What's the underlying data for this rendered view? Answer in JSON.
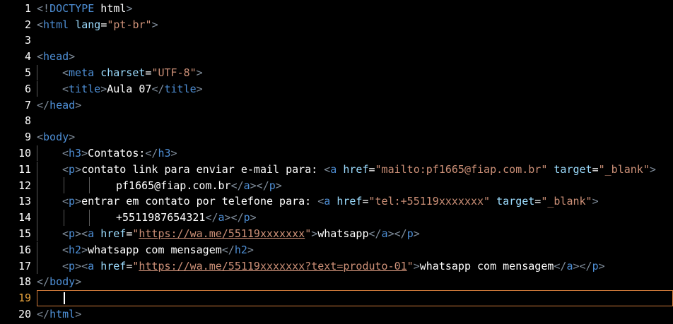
{
  "editor": {
    "current_line": 19,
    "colors": {
      "background": "#000000",
      "tag": "#4e8fd6",
      "attribute": "#9cdcfe",
      "string": "#ce9178",
      "text": "#ffffff",
      "punctuation": "#7f8c9a",
      "active_line_border": "#d07a3a"
    },
    "lines": [
      {
        "number": "1",
        "indent": 0,
        "tokens": [
          [
            "punc",
            "<!"
          ],
          [
            "tag",
            "DOCTYPE"
          ],
          [
            "text",
            " html"
          ],
          [
            "punc",
            ">"
          ]
        ]
      },
      {
        "number": "2",
        "indent": 0,
        "tokens": [
          [
            "punc",
            "<"
          ],
          [
            "tag",
            "html"
          ],
          [
            "text",
            " "
          ],
          [
            "attr",
            "lang"
          ],
          [
            "text",
            "="
          ],
          [
            "str",
            "\"pt-br\""
          ],
          [
            "punc",
            ">"
          ]
        ]
      },
      {
        "number": "3",
        "indent": 0,
        "tokens": []
      },
      {
        "number": "4",
        "indent": 0,
        "tokens": [
          [
            "punc",
            "<"
          ],
          [
            "tag",
            "head"
          ],
          [
            "punc",
            ">"
          ]
        ]
      },
      {
        "number": "5",
        "indent": 1,
        "tokens": [
          [
            "punc",
            "<"
          ],
          [
            "tag",
            "meta"
          ],
          [
            "text",
            " "
          ],
          [
            "attr",
            "charset"
          ],
          [
            "text",
            "="
          ],
          [
            "str",
            "\"UTF-8\""
          ],
          [
            "punc",
            ">"
          ]
        ]
      },
      {
        "number": "6",
        "indent": 1,
        "tokens": [
          [
            "punc",
            "<"
          ],
          [
            "tag",
            "title"
          ],
          [
            "punc",
            ">"
          ],
          [
            "text",
            "Aula 07"
          ],
          [
            "punc",
            "</"
          ],
          [
            "tag",
            "title"
          ],
          [
            "punc",
            ">"
          ]
        ]
      },
      {
        "number": "7",
        "indent": 0,
        "tokens": [
          [
            "punc",
            "</"
          ],
          [
            "tag",
            "head"
          ],
          [
            "punc",
            ">"
          ]
        ]
      },
      {
        "number": "8",
        "indent": 0,
        "tokens": []
      },
      {
        "number": "9",
        "indent": 0,
        "tokens": [
          [
            "punc",
            "<"
          ],
          [
            "tag",
            "body"
          ],
          [
            "punc",
            ">"
          ]
        ]
      },
      {
        "number": "10",
        "indent": 1,
        "tokens": [
          [
            "punc",
            "<"
          ],
          [
            "tag",
            "h3"
          ],
          [
            "punc",
            ">"
          ],
          [
            "text",
            "Contatos:"
          ],
          [
            "punc",
            "</"
          ],
          [
            "tag",
            "h3"
          ],
          [
            "punc",
            ">"
          ]
        ]
      },
      {
        "number": "11",
        "indent": 1,
        "tokens": [
          [
            "punc",
            "<"
          ],
          [
            "tag",
            "p"
          ],
          [
            "punc",
            ">"
          ],
          [
            "text",
            "contato link para enviar e-mail para: "
          ],
          [
            "punc",
            "<"
          ],
          [
            "tag",
            "a"
          ],
          [
            "text",
            " "
          ],
          [
            "attr",
            "href"
          ],
          [
            "text",
            "="
          ],
          [
            "str",
            "\"mailto:pf1665@fiap.com.br\""
          ],
          [
            "text",
            " "
          ],
          [
            "attr",
            "target"
          ],
          [
            "text",
            "="
          ],
          [
            "str",
            "\"_blank\""
          ],
          [
            "punc",
            ">"
          ]
        ]
      },
      {
        "number": "12",
        "indent": 3,
        "tokens": [
          [
            "text",
            "pf1665@fiap.com.br"
          ],
          [
            "punc",
            "</"
          ],
          [
            "tag",
            "a"
          ],
          [
            "punc",
            "></"
          ],
          [
            "tag",
            "p"
          ],
          [
            "punc",
            ">"
          ]
        ]
      },
      {
        "number": "13",
        "indent": 1,
        "tokens": [
          [
            "punc",
            "<"
          ],
          [
            "tag",
            "p"
          ],
          [
            "punc",
            ">"
          ],
          [
            "text",
            "entrar em contato por telefone para: "
          ],
          [
            "punc",
            "<"
          ],
          [
            "tag",
            "a"
          ],
          [
            "text",
            " "
          ],
          [
            "attr",
            "href"
          ],
          [
            "text",
            "="
          ],
          [
            "str",
            "\"tel:+55119xxxxxxx\""
          ],
          [
            "text",
            " "
          ],
          [
            "attr",
            "target"
          ],
          [
            "text",
            "="
          ],
          [
            "str",
            "\"_blank\""
          ],
          [
            "punc",
            ">"
          ]
        ]
      },
      {
        "number": "14",
        "indent": 3,
        "tokens": [
          [
            "text",
            "+5511987654321"
          ],
          [
            "punc",
            "</"
          ],
          [
            "tag",
            "a"
          ],
          [
            "punc",
            "></"
          ],
          [
            "tag",
            "p"
          ],
          [
            "punc",
            ">"
          ]
        ]
      },
      {
        "number": "15",
        "indent": 1,
        "tokens": [
          [
            "punc",
            "<"
          ],
          [
            "tag",
            "p"
          ],
          [
            "punc",
            "><"
          ],
          [
            "tag",
            "a"
          ],
          [
            "text",
            " "
          ],
          [
            "attr",
            "href"
          ],
          [
            "text",
            "="
          ],
          [
            "str",
            "\""
          ],
          [
            "url",
            "https://wa.me/55119xxxxxxx"
          ],
          [
            "str",
            "\""
          ],
          [
            "punc",
            ">"
          ],
          [
            "text",
            "whatsapp"
          ],
          [
            "punc",
            "</"
          ],
          [
            "tag",
            "a"
          ],
          [
            "punc",
            "></"
          ],
          [
            "tag",
            "p"
          ],
          [
            "punc",
            ">"
          ]
        ]
      },
      {
        "number": "16",
        "indent": 1,
        "tokens": [
          [
            "punc",
            "<"
          ],
          [
            "tag",
            "h2"
          ],
          [
            "punc",
            ">"
          ],
          [
            "text",
            "whatsapp com mensagem"
          ],
          [
            "punc",
            "</"
          ],
          [
            "tag",
            "h2"
          ],
          [
            "punc",
            ">"
          ]
        ]
      },
      {
        "number": "17",
        "indent": 1,
        "tokens": [
          [
            "punc",
            "<"
          ],
          [
            "tag",
            "p"
          ],
          [
            "punc",
            "><"
          ],
          [
            "tag",
            "a"
          ],
          [
            "text",
            " "
          ],
          [
            "attr",
            "href"
          ],
          [
            "text",
            "="
          ],
          [
            "str",
            "\""
          ],
          [
            "url",
            "https://wa.me/55119xxxxxxx?text=produto-01"
          ],
          [
            "str",
            "\""
          ],
          [
            "punc",
            ">"
          ],
          [
            "text",
            "whatsapp com mensagem"
          ],
          [
            "punc",
            "</"
          ],
          [
            "tag",
            "a"
          ],
          [
            "punc",
            "></"
          ],
          [
            "tag",
            "p"
          ],
          [
            "punc",
            ">"
          ]
        ]
      },
      {
        "number": "18",
        "indent": 0,
        "tokens": [
          [
            "punc",
            "</"
          ],
          [
            "tag",
            "body"
          ],
          [
            "punc",
            ">"
          ]
        ]
      },
      {
        "number": "19",
        "indent": 0,
        "tokens": []
      },
      {
        "number": "20",
        "indent": 0,
        "tokens": [
          [
            "punc",
            "</"
          ],
          [
            "tag",
            "html"
          ],
          [
            "punc",
            ">"
          ]
        ]
      }
    ]
  }
}
